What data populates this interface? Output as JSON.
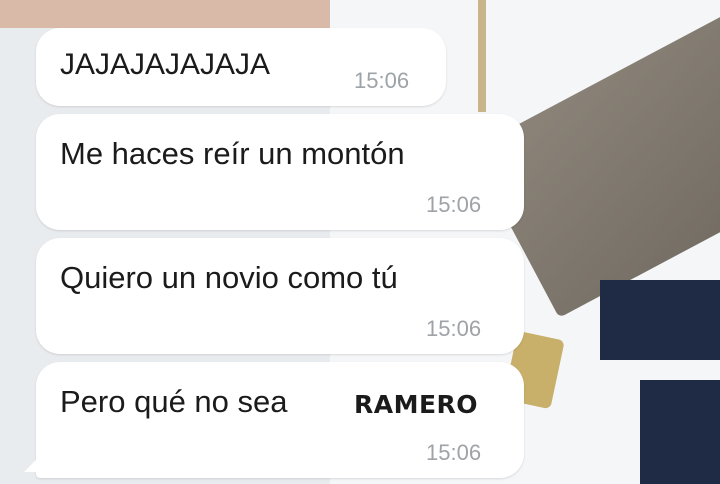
{
  "messages": [
    {
      "text": "JAJAJAJAJAJA",
      "time": "15:06"
    },
    {
      "text": "Me haces reír un montón",
      "time": "15:06"
    },
    {
      "text": "Quiero un novio como tú",
      "time": "15:06"
    },
    {
      "text": "Pero qué no sea",
      "sticker": "RAMERO",
      "time": "15:06"
    }
  ]
}
